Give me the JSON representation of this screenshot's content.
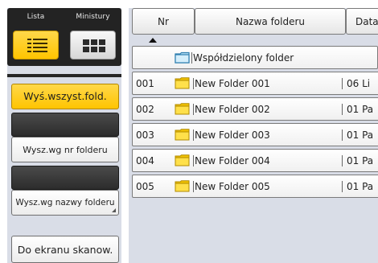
{
  "view_toggle": {
    "list_label": "Lista",
    "thumbnail_label": "Ministury"
  },
  "sidebar": {
    "show_all_folders": "Wyś.wszyst.fold.",
    "search_by_number": "Wysz.wg nr folderu",
    "search_by_name": "Wysz.wg nazwy folderu",
    "to_scan_screen": "Do ekranu skanow."
  },
  "table": {
    "headers": {
      "number": "Nr",
      "folder_name": "Nazwa folderu",
      "date": "Data"
    },
    "sort": "ascending-by-number",
    "shared_folder": "Współdzielony folder",
    "rows": [
      {
        "nr": "001",
        "name": "New Folder 001",
        "date": "06 Li"
      },
      {
        "nr": "002",
        "name": "New Folder 002",
        "date": "01 Pa"
      },
      {
        "nr": "003",
        "name": "New Folder 003",
        "date": "01 Pa"
      },
      {
        "nr": "004",
        "name": "New Folder 004",
        "date": "01 Pa"
      },
      {
        "nr": "005",
        "name": "New Folder 005",
        "date": "01 Pa"
      }
    ]
  },
  "icons": {
    "list_view": "list-view-icon",
    "thumbnail_view": "grid-view-icon",
    "folder": "folder-icon",
    "shared_folder": "shared-folder-icon",
    "sort": "sort-ascending-icon"
  },
  "colors": {
    "accent_yellow": "#ffcc1f",
    "panel_background": "#d9dde7",
    "dark": "#262626",
    "folder_yellow": "#ffde3c",
    "shared_folder_blue": "#b8e0f6"
  }
}
